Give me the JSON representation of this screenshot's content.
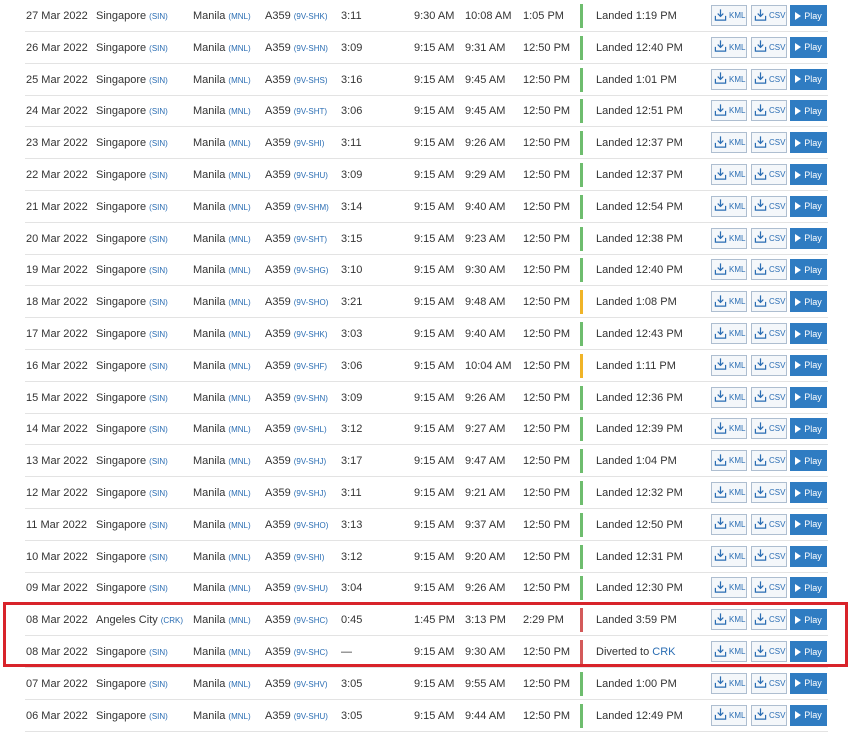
{
  "buttons": {
    "kml_label": "KML",
    "csv_label": "CSV",
    "play_label": "Play"
  },
  "highlight_color": "#d8232a",
  "status_colors": {
    "green": "#6ebd6e",
    "yellow": "#f0b428",
    "red": "#d35a5a"
  },
  "flights": [
    {
      "date": "27 Mar 2022",
      "from_city": "Singapore",
      "from_code": "(SIN)",
      "to_city": "Manila",
      "to_code": "(MNL)",
      "aircraft": "A359",
      "reg": "(9V-SHK)",
      "duration": "3:11",
      "std": "9:30 AM",
      "atd": "10:08 AM",
      "sta": "1:05 PM",
      "status": "Landed 1:19 PM",
      "status_link": "",
      "bar": "green"
    },
    {
      "date": "26 Mar 2022",
      "from_city": "Singapore",
      "from_code": "(SIN)",
      "to_city": "Manila",
      "to_code": "(MNL)",
      "aircraft": "A359",
      "reg": "(9V-SHN)",
      "duration": "3:09",
      "std": "9:15 AM",
      "atd": "9:31 AM",
      "sta": "12:50 PM",
      "status": "Landed 12:40 PM",
      "status_link": "",
      "bar": "green"
    },
    {
      "date": "25 Mar 2022",
      "from_city": "Singapore",
      "from_code": "(SIN)",
      "to_city": "Manila",
      "to_code": "(MNL)",
      "aircraft": "A359",
      "reg": "(9V-SHS)",
      "duration": "3:16",
      "std": "9:15 AM",
      "atd": "9:45 AM",
      "sta": "12:50 PM",
      "status": "Landed 1:01 PM",
      "status_link": "",
      "bar": "green"
    },
    {
      "date": "24 Mar 2022",
      "from_city": "Singapore",
      "from_code": "(SIN)",
      "to_city": "Manila",
      "to_code": "(MNL)",
      "aircraft": "A359",
      "reg": "(9V-SHT)",
      "duration": "3:06",
      "std": "9:15 AM",
      "atd": "9:45 AM",
      "sta": "12:50 PM",
      "status": "Landed 12:51 PM",
      "status_link": "",
      "bar": "green"
    },
    {
      "date": "23 Mar 2022",
      "from_city": "Singapore",
      "from_code": "(SIN)",
      "to_city": "Manila",
      "to_code": "(MNL)",
      "aircraft": "A359",
      "reg": "(9V-SHI)",
      "duration": "3:11",
      "std": "9:15 AM",
      "atd": "9:26 AM",
      "sta": "12:50 PM",
      "status": "Landed 12:37 PM",
      "status_link": "",
      "bar": "green"
    },
    {
      "date": "22 Mar 2022",
      "from_city": "Singapore",
      "from_code": "(SIN)",
      "to_city": "Manila",
      "to_code": "(MNL)",
      "aircraft": "A359",
      "reg": "(9V-SHU)",
      "duration": "3:09",
      "std": "9:15 AM",
      "atd": "9:29 AM",
      "sta": "12:50 PM",
      "status": "Landed 12:37 PM",
      "status_link": "",
      "bar": "green"
    },
    {
      "date": "21 Mar 2022",
      "from_city": "Singapore",
      "from_code": "(SIN)",
      "to_city": "Manila",
      "to_code": "(MNL)",
      "aircraft": "A359",
      "reg": "(9V-SHM)",
      "duration": "3:14",
      "std": "9:15 AM",
      "atd": "9:40 AM",
      "sta": "12:50 PM",
      "status": "Landed 12:54 PM",
      "status_link": "",
      "bar": "green"
    },
    {
      "date": "20 Mar 2022",
      "from_city": "Singapore",
      "from_code": "(SIN)",
      "to_city": "Manila",
      "to_code": "(MNL)",
      "aircraft": "A359",
      "reg": "(9V-SHT)",
      "duration": "3:15",
      "std": "9:15 AM",
      "atd": "9:23 AM",
      "sta": "12:50 PM",
      "status": "Landed 12:38 PM",
      "status_link": "",
      "bar": "green"
    },
    {
      "date": "19 Mar 2022",
      "from_city": "Singapore",
      "from_code": "(SIN)",
      "to_city": "Manila",
      "to_code": "(MNL)",
      "aircraft": "A359",
      "reg": "(9V-SHG)",
      "duration": "3:10",
      "std": "9:15 AM",
      "atd": "9:30 AM",
      "sta": "12:50 PM",
      "status": "Landed 12:40 PM",
      "status_link": "",
      "bar": "green"
    },
    {
      "date": "18 Mar 2022",
      "from_city": "Singapore",
      "from_code": "(SIN)",
      "to_city": "Manila",
      "to_code": "(MNL)",
      "aircraft": "A359",
      "reg": "(9V-SHO)",
      "duration": "3:21",
      "std": "9:15 AM",
      "atd": "9:48 AM",
      "sta": "12:50 PM",
      "status": "Landed 1:08 PM",
      "status_link": "",
      "bar": "yellow"
    },
    {
      "date": "17 Mar 2022",
      "from_city": "Singapore",
      "from_code": "(SIN)",
      "to_city": "Manila",
      "to_code": "(MNL)",
      "aircraft": "A359",
      "reg": "(9V-SHK)",
      "duration": "3:03",
      "std": "9:15 AM",
      "atd": "9:40 AM",
      "sta": "12:50 PM",
      "status": "Landed 12:43 PM",
      "status_link": "",
      "bar": "green"
    },
    {
      "date": "16 Mar 2022",
      "from_city": "Singapore",
      "from_code": "(SIN)",
      "to_city": "Manila",
      "to_code": "(MNL)",
      "aircraft": "A359",
      "reg": "(9V-SHF)",
      "duration": "3:06",
      "std": "9:15 AM",
      "atd": "10:04 AM",
      "sta": "12:50 PM",
      "status": "Landed 1:11 PM",
      "status_link": "",
      "bar": "yellow"
    },
    {
      "date": "15 Mar 2022",
      "from_city": "Singapore",
      "from_code": "(SIN)",
      "to_city": "Manila",
      "to_code": "(MNL)",
      "aircraft": "A359",
      "reg": "(9V-SHN)",
      "duration": "3:09",
      "std": "9:15 AM",
      "atd": "9:26 AM",
      "sta": "12:50 PM",
      "status": "Landed 12:36 PM",
      "status_link": "",
      "bar": "green"
    },
    {
      "date": "14 Mar 2022",
      "from_city": "Singapore",
      "from_code": "(SIN)",
      "to_city": "Manila",
      "to_code": "(MNL)",
      "aircraft": "A359",
      "reg": "(9V-SHL)",
      "duration": "3:12",
      "std": "9:15 AM",
      "atd": "9:27 AM",
      "sta": "12:50 PM",
      "status": "Landed 12:39 PM",
      "status_link": "",
      "bar": "green"
    },
    {
      "date": "13 Mar 2022",
      "from_city": "Singapore",
      "from_code": "(SIN)",
      "to_city": "Manila",
      "to_code": "(MNL)",
      "aircraft": "A359",
      "reg": "(9V-SHJ)",
      "duration": "3:17",
      "std": "9:15 AM",
      "atd": "9:47 AM",
      "sta": "12:50 PM",
      "status": "Landed 1:04 PM",
      "status_link": "",
      "bar": "green"
    },
    {
      "date": "12 Mar 2022",
      "from_city": "Singapore",
      "from_code": "(SIN)",
      "to_city": "Manila",
      "to_code": "(MNL)",
      "aircraft": "A359",
      "reg": "(9V-SHJ)",
      "duration": "3:11",
      "std": "9:15 AM",
      "atd": "9:21 AM",
      "sta": "12:50 PM",
      "status": "Landed 12:32 PM",
      "status_link": "",
      "bar": "green"
    },
    {
      "date": "11 Mar 2022",
      "from_city": "Singapore",
      "from_code": "(SIN)",
      "to_city": "Manila",
      "to_code": "(MNL)",
      "aircraft": "A359",
      "reg": "(9V-SHO)",
      "duration": "3:13",
      "std": "9:15 AM",
      "atd": "9:37 AM",
      "sta": "12:50 PM",
      "status": "Landed 12:50 PM",
      "status_link": "",
      "bar": "green"
    },
    {
      "date": "10 Mar 2022",
      "from_city": "Singapore",
      "from_code": "(SIN)",
      "to_city": "Manila",
      "to_code": "(MNL)",
      "aircraft": "A359",
      "reg": "(9V-SHI)",
      "duration": "3:12",
      "std": "9:15 AM",
      "atd": "9:20 AM",
      "sta": "12:50 PM",
      "status": "Landed 12:31 PM",
      "status_link": "",
      "bar": "green"
    },
    {
      "date": "09 Mar 2022",
      "from_city": "Singapore",
      "from_code": "(SIN)",
      "to_city": "Manila",
      "to_code": "(MNL)",
      "aircraft": "A359",
      "reg": "(9V-SHU)",
      "duration": "3:04",
      "std": "9:15 AM",
      "atd": "9:26 AM",
      "sta": "12:50 PM",
      "status": "Landed 12:30 PM",
      "status_link": "",
      "bar": "green"
    },
    {
      "date": "08 Mar 2022",
      "from_city": "Angeles City",
      "from_code": "(CRK)",
      "to_city": "Manila",
      "to_code": "(MNL)",
      "aircraft": "A359",
      "reg": "(9V-SHC)",
      "duration": "0:45",
      "std": "1:45 PM",
      "atd": "3:13 PM",
      "sta": "2:29 PM",
      "status": "Landed 3:59 PM",
      "status_link": "",
      "bar": "red"
    },
    {
      "date": "08 Mar 2022",
      "from_city": "Singapore",
      "from_code": "(SIN)",
      "to_city": "Manila",
      "to_code": "(MNL)",
      "aircraft": "A359",
      "reg": "(9V-SHC)",
      "duration": "—",
      "std": "9:15 AM",
      "atd": "9:30 AM",
      "sta": "12:50 PM",
      "status": "Diverted to ",
      "status_link": "CRK",
      "bar": "red"
    },
    {
      "date": "07 Mar 2022",
      "from_city": "Singapore",
      "from_code": "(SIN)",
      "to_city": "Manila",
      "to_code": "(MNL)",
      "aircraft": "A359",
      "reg": "(9V-SHV)",
      "duration": "3:05",
      "std": "9:15 AM",
      "atd": "9:55 AM",
      "sta": "12:50 PM",
      "status": "Landed 1:00 PM",
      "status_link": "",
      "bar": "green"
    },
    {
      "date": "06 Mar 2022",
      "from_city": "Singapore",
      "from_code": "(SIN)",
      "to_city": "Manila",
      "to_code": "(MNL)",
      "aircraft": "A359",
      "reg": "(9V-SHU)",
      "duration": "3:05",
      "std": "9:15 AM",
      "atd": "9:44 AM",
      "sta": "12:50 PM",
      "status": "Landed 12:49 PM",
      "status_link": "",
      "bar": "green"
    }
  ]
}
